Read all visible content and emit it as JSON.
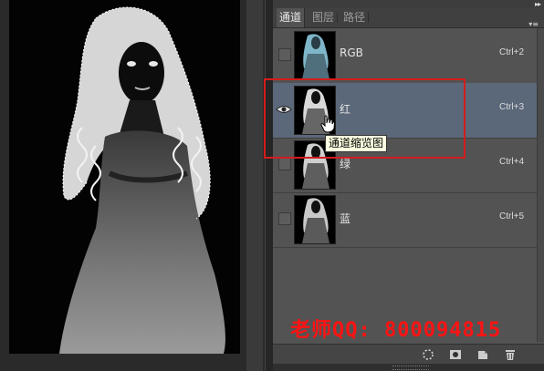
{
  "panel": {
    "tabs": [
      {
        "label": "通道",
        "active": true
      },
      {
        "label": "图层",
        "active": false
      },
      {
        "label": "路径",
        "active": false
      }
    ],
    "menu_icon": "panel-menu-icon",
    "collapse_icon": "collapse-arrows-icon"
  },
  "channels": [
    {
      "name": "RGB",
      "shortcut": "Ctrl+2",
      "visible": false,
      "selected": false,
      "thumb_tint": "#7fb5c9"
    },
    {
      "name": "红",
      "shortcut": "Ctrl+3",
      "visible": true,
      "selected": true,
      "thumb_tint": "#d8d8d8"
    },
    {
      "name": "绿",
      "shortcut": "Ctrl+4",
      "visible": false,
      "selected": false,
      "thumb_tint": "#cfcfcf"
    },
    {
      "name": "蓝",
      "shortcut": "Ctrl+5",
      "visible": false,
      "selected": false,
      "thumb_tint": "#c8c8c8"
    }
  ],
  "tooltip": "通道缩览图",
  "watermark": "老师QQ: 800094815",
  "bottom_buttons": [
    "load-selection-icon",
    "save-mask-icon",
    "new-channel-icon",
    "trash-icon"
  ],
  "colors": {
    "selection_row": "#5b6879",
    "highlight": "#d41c1c",
    "watermark": "#ff1313"
  }
}
